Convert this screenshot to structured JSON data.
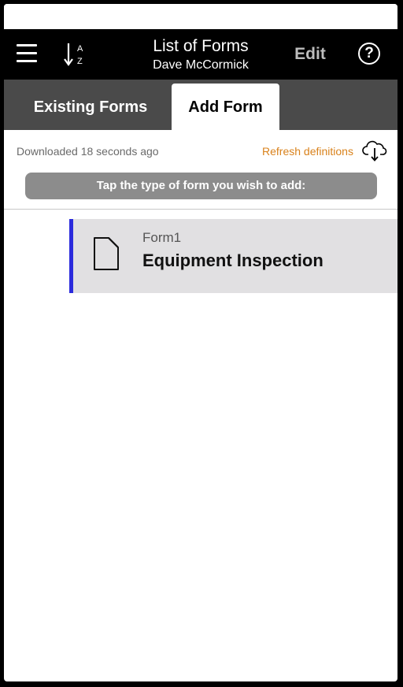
{
  "header": {
    "title": "List of Forms",
    "subtitle": "Dave McCormick",
    "edit_label": "Edit",
    "help_label": "?",
    "sort_icon_text_top": "A",
    "sort_icon_text_bottom": "Z"
  },
  "tabs": [
    {
      "label": "Existing Forms",
      "active": false
    },
    {
      "label": "Add Form",
      "active": true
    }
  ],
  "status": {
    "downloaded_text": "Downloaded 18 seconds ago",
    "refresh_label": "Refresh definitions"
  },
  "instruction": "Tap the type of form you wish to add:",
  "forms": [
    {
      "id": "Form1",
      "name": "Equipment Inspection"
    }
  ],
  "colors": {
    "accent": "#2b2bdc",
    "refresh": "#d9821c",
    "tabbar": "#4a4a4a",
    "navbar": "#000000"
  }
}
